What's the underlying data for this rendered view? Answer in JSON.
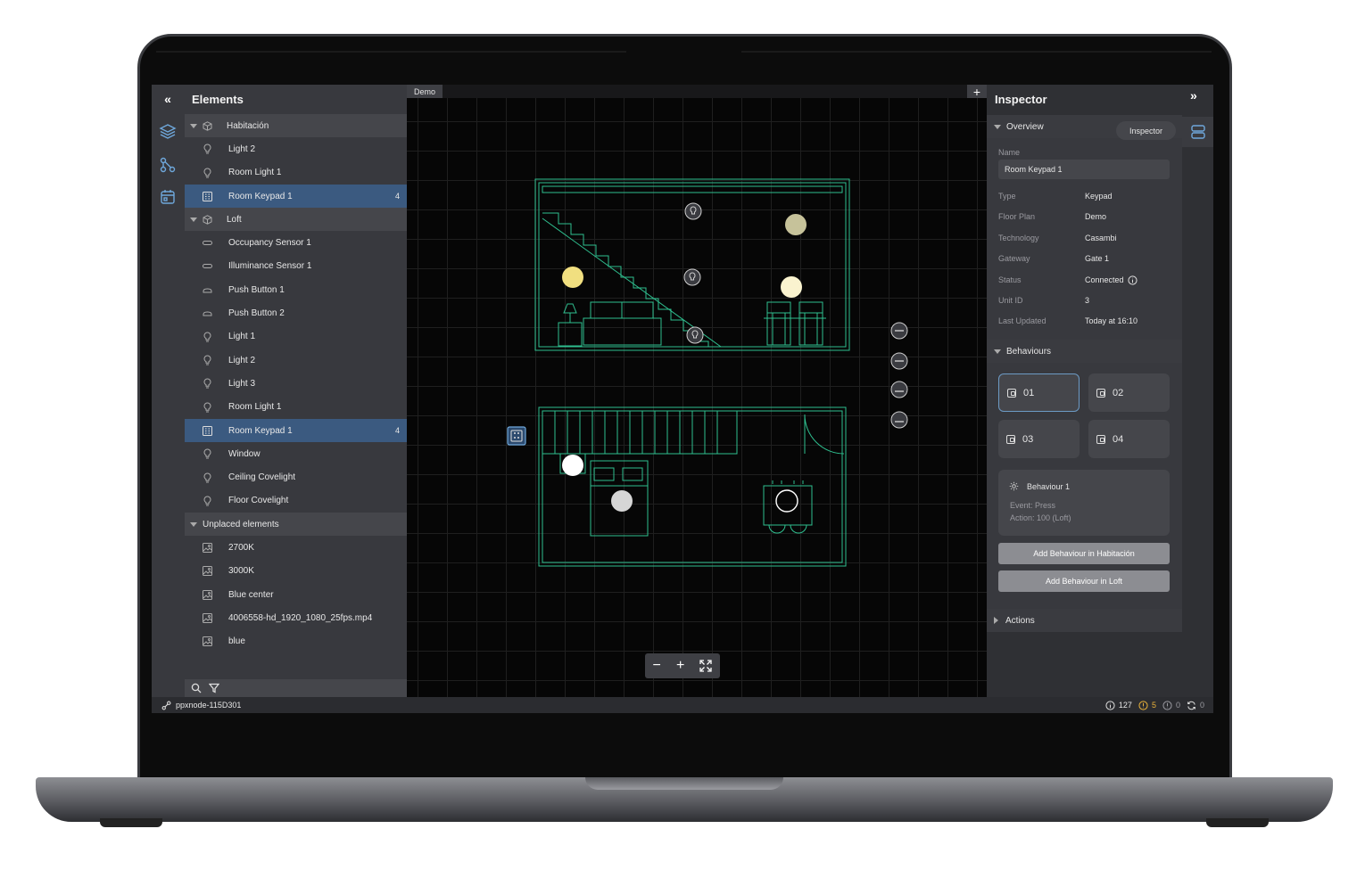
{
  "elements_panel": {
    "title": "Elements",
    "groups": [
      {
        "name": "Habitación",
        "items": [
          {
            "label": "Light 2",
            "icon": "bulb-icon"
          },
          {
            "label": "Room Light 1",
            "icon": "bulb-icon"
          },
          {
            "label": "Room Keypad 1",
            "icon": "keypad-icon",
            "count": "4",
            "selected": true
          }
        ]
      },
      {
        "name": "Loft",
        "items": [
          {
            "label": "Occupancy Sensor 1",
            "icon": "sensor-icon"
          },
          {
            "label": "Illuminance Sensor 1",
            "icon": "sensor-icon"
          },
          {
            "label": "Push Button 1",
            "icon": "button-icon"
          },
          {
            "label": "Push Button 2",
            "icon": "button-icon"
          },
          {
            "label": "Light 1",
            "icon": "bulb-icon"
          },
          {
            "label": "Light 2",
            "icon": "bulb-icon"
          },
          {
            "label": "Light 3",
            "icon": "bulb-icon"
          },
          {
            "label": "Room Light 1",
            "icon": "bulb-icon"
          },
          {
            "label": "Room Keypad 1",
            "icon": "keypad-icon",
            "count": "4",
            "selected": true
          },
          {
            "label": "Window",
            "icon": "bulb-icon"
          },
          {
            "label": "Ceiling Covelight",
            "icon": "bulb-icon"
          },
          {
            "label": "Floor Covelight",
            "icon": "bulb-icon"
          }
        ]
      },
      {
        "name": "Unplaced elements",
        "items": [
          {
            "label": "2700K",
            "icon": "image-icon"
          },
          {
            "label": "3000K",
            "icon": "image-icon"
          },
          {
            "label": "Blue center",
            "icon": "image-icon"
          },
          {
            "label": "4006558-hd_1920_1080_25fps.mp4",
            "icon": "image-icon"
          },
          {
            "label": "blue",
            "icon": "image-icon"
          }
        ]
      }
    ]
  },
  "canvas": {
    "tab_label": "Demo",
    "zoom_out": "−",
    "zoom_in": "+"
  },
  "inspector": {
    "title": "Inspector",
    "tooltip": "Inspector",
    "overview": {
      "section": "Overview",
      "name_label": "Name",
      "name_value": "Room Keypad 1",
      "fields": [
        {
          "label": "Type",
          "value": "Keypad"
        },
        {
          "label": "Floor Plan",
          "value": "Demo"
        },
        {
          "label": "Technology",
          "value": "Casambi"
        },
        {
          "label": "Gateway",
          "value": "Gate 1"
        },
        {
          "label": "Status",
          "value": "Connected"
        },
        {
          "label": "Unit ID",
          "value": "3"
        },
        {
          "label": "Last Updated",
          "value": "Today at 16:10"
        }
      ]
    },
    "behaviours": {
      "section": "Behaviours",
      "buttons": [
        "01",
        "02",
        "03",
        "04"
      ],
      "card": {
        "title": "Behaviour 1",
        "event": "Event: Press",
        "action": "Action: 100 (Loft)"
      },
      "add_habitacion": "Add Behaviour in Habitación",
      "add_loft": "Add Behaviour in Loft"
    },
    "actions": {
      "section": "Actions"
    }
  },
  "status_bar": {
    "node": "ppxnode-115D301",
    "info_count": "127",
    "warn_count": "5",
    "error_count": "0",
    "sync_count": "0"
  },
  "colors": {
    "accent_selected": "#3b5a80",
    "floorplan_line": "#2fbf8f",
    "warning": "#e8b13a"
  }
}
